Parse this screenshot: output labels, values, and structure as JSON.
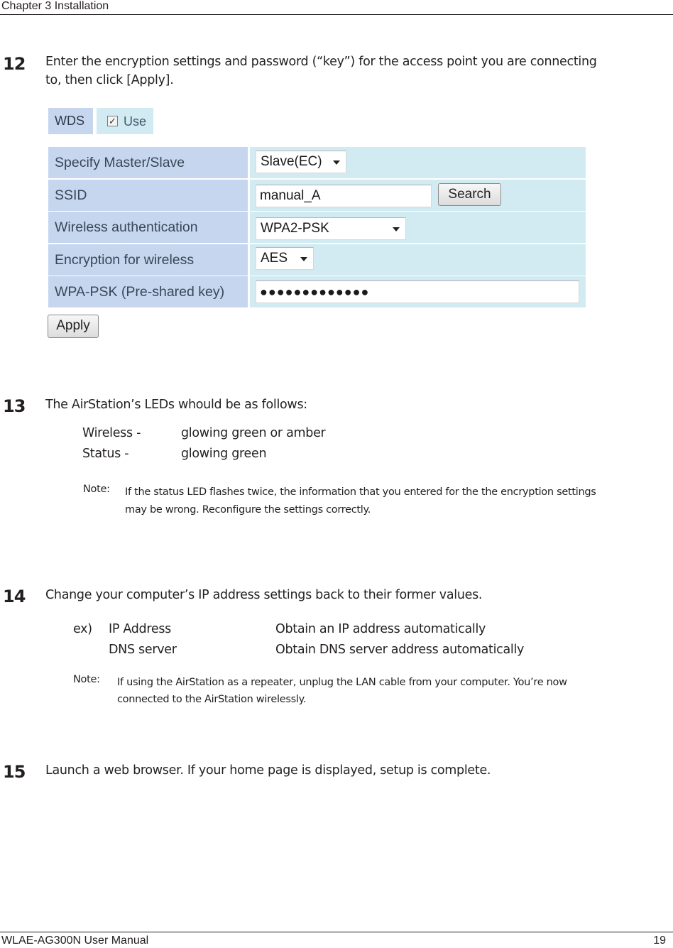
{
  "header": {
    "chapter": "Chapter 3  Installation"
  },
  "footer": {
    "manual": "WLAE-AG300N User Manual",
    "page": "19"
  },
  "steps": [
    {
      "number": "12",
      "text_line1": "Enter the encryption settings and password (“key”) for the access point you are connecting",
      "text_line2": "to, then click [Apply]."
    },
    {
      "number": "13",
      "text": "The AirStation’s LEDs whould be as follows:",
      "leds": [
        {
          "name": "Wireless -",
          "state": "glowing green or amber"
        },
        {
          "name": "Status -",
          "state": "glowing green"
        }
      ],
      "note_label": "Note:",
      "note_line1": "If the status LED flashes twice, the information that you entered for the the encryption settings",
      "note_line2": "may be wrong.  Reconfigure the settings correctly."
    },
    {
      "number": "14",
      "text": "Change your computer’s IP address settings back to their former values.",
      "ex_label": "ex)",
      "settings": [
        {
          "name": "IP Address",
          "value": "Obtain an IP address automatically"
        },
        {
          "name": "DNS server",
          "value": "Obtain DNS server address automatically"
        }
      ],
      "note_label": "Note:",
      "note_line1": "If using the AirStation as a repeater, unplug the LAN cable from your computer.  You’re now",
      "note_line2": "connected to the AirStation wirelessly."
    },
    {
      "number": "15",
      "text": "Launch a web browser.  If your home page is displayed, setup is complete."
    }
  ],
  "wds_form": {
    "wds_label": "WDS",
    "use_label": "Use",
    "use_checked": true,
    "rows": [
      {
        "label": "Specify Master/Slave",
        "value": "Slave(EC)"
      },
      {
        "label": "SSID",
        "value": "manual_A",
        "button": "Search"
      },
      {
        "label": "Wireless authentication",
        "value": "WPA2-PSK"
      },
      {
        "label": "Encryption for wireless",
        "value": "AES"
      },
      {
        "label": "WPA-PSK (Pre-shared key)",
        "value": "●●●●●●●●●●●●●"
      }
    ],
    "apply_button": "Apply"
  }
}
